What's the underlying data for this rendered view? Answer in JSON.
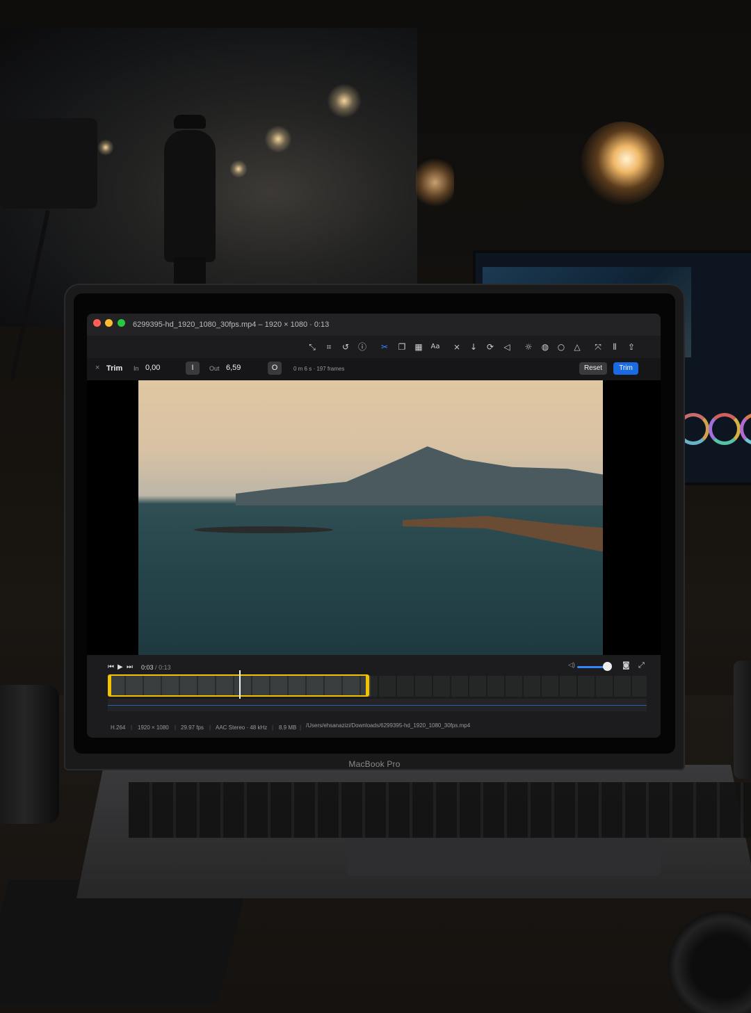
{
  "window": {
    "title": "6299395-hd_1920_1080_30fps.mp4 – 1920 × 1080 · 0:13",
    "brand": "MacBook Pro"
  },
  "toolbar": {
    "back_icon": "chevron-left-icon",
    "icons": [
      "expand-icon",
      "crop-icon",
      "rotate-icon",
      "info-icon",
      "scissors-icon",
      "layers-icon",
      "grid-icon",
      "text-icon",
      "mute-icon",
      "download-icon",
      "loop-icon",
      "volume-icon",
      "brightness-icon",
      "color-icon",
      "circle-icon",
      "triangle-icon",
      "compress-icon",
      "split-icon",
      "share-icon"
    ],
    "text_icon_label": "Aa",
    "active_icon": "scissors-icon",
    "accent": "#2f87ff"
  },
  "trim": {
    "close": "×",
    "label": "Trim",
    "in_label": "In",
    "in_value": "0,00",
    "in_button": "I",
    "out_label": "Out",
    "out_value": "6,59",
    "out_button": "O",
    "duration": "0 m 6 s · 197 frames",
    "reset_label": "Reset",
    "trim_label": "Trim"
  },
  "player": {
    "current_time": "0:03",
    "separator": "/",
    "total_time": "0:13",
    "volume_level": 0.85,
    "selection_color": "#f2c400"
  },
  "status": {
    "codec": "H.264",
    "resolution": "1920 × 1080",
    "fps": "29.97 fps",
    "audio": "AAC Stereo · 48 kHz",
    "size": "8.9 MB",
    "path": "/Users/ehsanazizi/Downloads/6299395-hd_1920_1080_30fps.mp4"
  }
}
